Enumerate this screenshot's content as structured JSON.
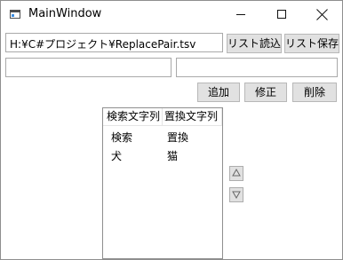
{
  "window": {
    "title": "MainWindow"
  },
  "file": {
    "path_value": "H:¥C#プロジェクト¥ReplacePair.tsv",
    "load_label": "リスト読込",
    "save_label": "リスト保存"
  },
  "editor": {
    "search_value": "",
    "replace_value": "",
    "add_label": "追加",
    "edit_label": "修正",
    "delete_label": "削除"
  },
  "list": {
    "columns": [
      "検索文字列",
      "置換文字列"
    ],
    "rows": [
      {
        "search": "検索",
        "replace": "置換"
      },
      {
        "search": "犬",
        "replace": "猫"
      }
    ]
  },
  "icons": {
    "window": "app-window-icon",
    "minimize": "minimize-icon",
    "maximize": "maximize-icon",
    "close": "close-icon",
    "move_up": "triangle-up-icon",
    "move_down": "triangle-down-icon"
  },
  "colors": {
    "window_border": "#8e8e8e",
    "button_face": "#e1e1e1",
    "button_border": "#b8b8b8",
    "text": "#000000"
  }
}
